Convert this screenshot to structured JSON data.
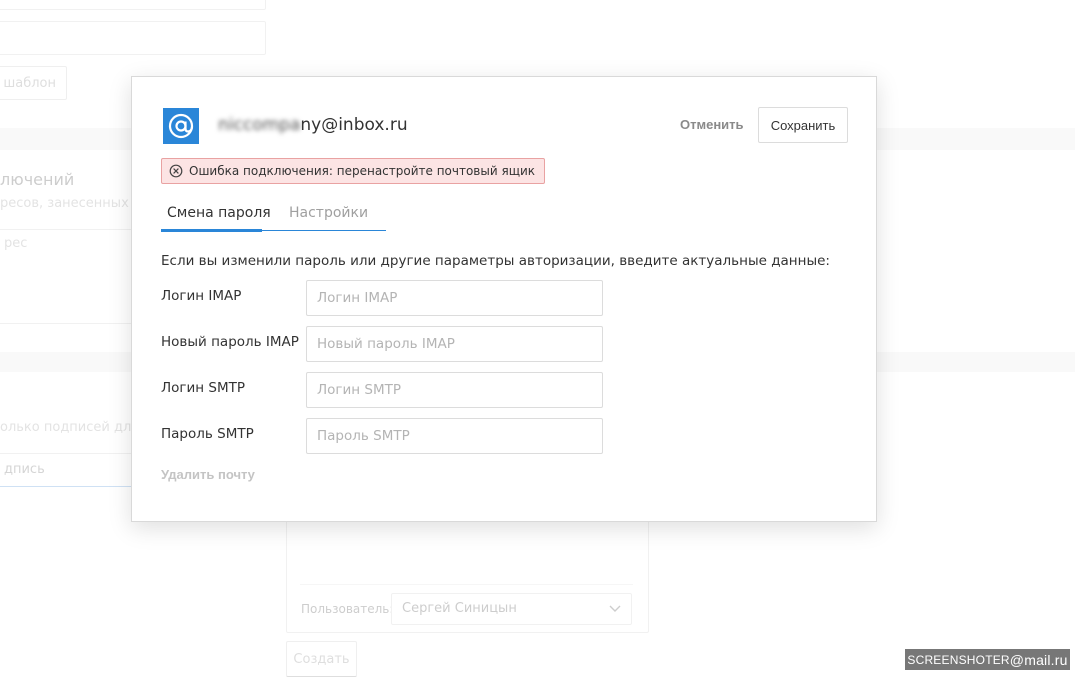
{
  "background": {
    "template_button": "шаблон",
    "section_title": "лючений",
    "section_subtitle": "ресов, занесенных в",
    "address_placeholder": "рес",
    "signatures_hint": "олько подписей для",
    "signature_field": "дпись",
    "user_label": "Пользователь:",
    "user_value": "Сергей Синицын",
    "create_button": "Создать"
  },
  "modal": {
    "icon": "at-sign-icon",
    "email_hidden": "niccompa",
    "email_visible": "ny@inbox.ru",
    "cancel": "Отменить",
    "save": "Сохранить",
    "error": "Ошибка подключения: перенастройте почтовый ящик",
    "tabs": [
      {
        "label": "Смена пароля",
        "active": true
      },
      {
        "label": "Настройки",
        "active": false
      }
    ],
    "description": "Если вы изменили пароль или другие параметры авторизации, введите актуальные данные:",
    "fields": [
      {
        "label": "Логин IMAP",
        "placeholder": "Логин IMAP",
        "value": ""
      },
      {
        "label": "Новый пароль IMAP",
        "placeholder": "Новый пароль IMAP",
        "value": ""
      },
      {
        "label": "Логин SMTP",
        "placeholder": "Логин SMTP",
        "value": ""
      },
      {
        "label": "Пароль SMTP",
        "placeholder": "Пароль SMTP",
        "value": ""
      }
    ],
    "delete": "Удалить почту"
  },
  "watermark": {
    "brand": "SCREENSHOTER",
    "domain": "@mail.ru"
  },
  "colors": {
    "accent": "#2a86d8",
    "error_bg": "#fce4e4",
    "error_border": "#e9a2a2"
  }
}
